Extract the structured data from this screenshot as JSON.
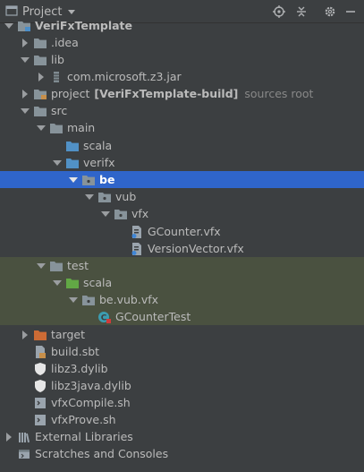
{
  "header": {
    "title": "Project",
    "icons": [
      "project-view-icon",
      "locate-icon",
      "collapse-all-icon",
      "settings-gear-icon",
      "hide-panel-icon"
    ]
  },
  "colors": {
    "background": "#3c3f41",
    "selection": "#2f65ca",
    "test_row": "#4a5140",
    "folder": "#87939a",
    "source_folder": "#5191c6",
    "test_folder": "#62a845",
    "excluded_folder": "#cc6b35"
  },
  "tree": {
    "rows": [
      {
        "label": "VeriFxTemplate",
        "bold": true,
        "icon": "module-folder-icon",
        "expanded": true
      },
      {
        "label": ".idea",
        "icon": "folder-icon",
        "expanded": false
      },
      {
        "label": "lib",
        "icon": "folder-icon",
        "expanded": true
      },
      {
        "label": "com.microsoft.z3.jar",
        "icon": "jar-icon",
        "expanded": false
      },
      {
        "label": "project",
        "suffix_bold": "[VeriFxTemplate-build]",
        "suffix": "sources root",
        "icon": "sources-root-folder-icon",
        "expanded": false
      },
      {
        "label": "src",
        "icon": "folder-icon",
        "expanded": true
      },
      {
        "label": "main",
        "icon": "folder-icon",
        "expanded": true
      },
      {
        "label": "scala",
        "icon": "source-folder-icon",
        "expanded": null
      },
      {
        "label": "verifx",
        "icon": "source-folder-icon",
        "expanded": true
      },
      {
        "label": "be",
        "icon": "package-icon",
        "expanded": true,
        "selected": true
      },
      {
        "label": "vub",
        "icon": "package-icon",
        "expanded": true
      },
      {
        "label": "vfx",
        "icon": "package-icon",
        "expanded": true
      },
      {
        "label": "GCounter.vfx",
        "icon": "vfx-file-icon",
        "expanded": null
      },
      {
        "label": "VersionVector.vfx",
        "icon": "vfx-file-icon",
        "expanded": null
      },
      {
        "label": "test",
        "icon": "folder-icon",
        "expanded": true
      },
      {
        "label": "scala",
        "icon": "test-folder-icon",
        "expanded": true
      },
      {
        "label": "be.vub.vfx",
        "icon": "package-icon",
        "expanded": true
      },
      {
        "label": "GCounterTest",
        "icon": "scala-test-class-icon",
        "expanded": null
      },
      {
        "label": "target",
        "icon": "excluded-folder-icon",
        "expanded": false
      },
      {
        "label": "build.sbt",
        "icon": "sbt-file-icon",
        "expanded": null
      },
      {
        "label": "libz3.dylib",
        "icon": "dylib-shield-icon",
        "expanded": null
      },
      {
        "label": "libz3java.dylib",
        "icon": "dylib-shield-icon",
        "expanded": null
      },
      {
        "label": "vfxCompile.sh",
        "icon": "shell-script-icon",
        "expanded": null
      },
      {
        "label": "vfxProve.sh",
        "icon": "shell-script-icon",
        "expanded": null
      },
      {
        "label": "External Libraries",
        "icon": "external-libraries-icon",
        "expanded": false
      },
      {
        "label": "Scratches and Consoles",
        "icon": "scratches-icon",
        "expanded": null
      }
    ]
  }
}
